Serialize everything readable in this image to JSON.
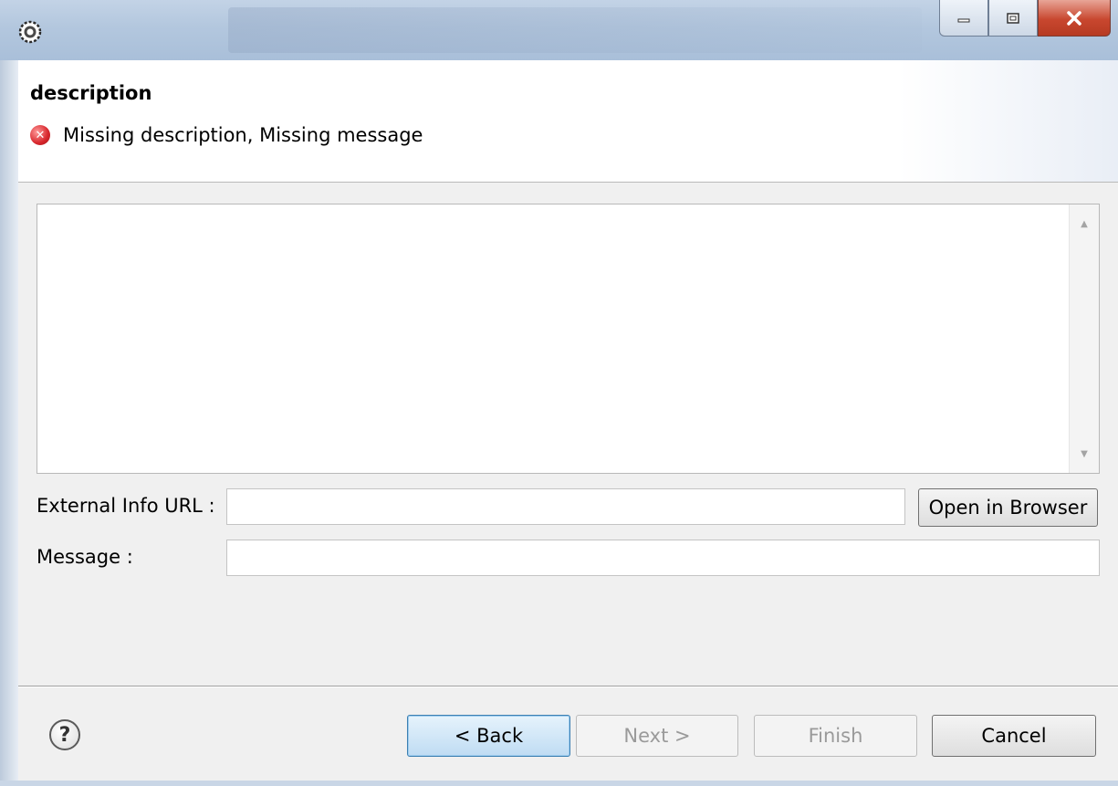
{
  "window": {
    "title_icon": "eclipse-gear-icon",
    "controls": {
      "minimize": "minimize-icon",
      "maximize": "maximize-icon",
      "close": "close-icon"
    }
  },
  "header": {
    "title": "description",
    "error_icon": "error-icon",
    "error_message": "Missing description, Missing message"
  },
  "form": {
    "description_value": "",
    "external_url_label": "External Info URL :",
    "external_url_value": "",
    "open_browser_label": "Open in Browser",
    "message_label": "Message :",
    "message_value": ""
  },
  "footer": {
    "help_icon": "help-icon",
    "back_label": "< Back",
    "next_label": "Next >",
    "finish_label": "Finish",
    "cancel_label": "Cancel"
  }
}
